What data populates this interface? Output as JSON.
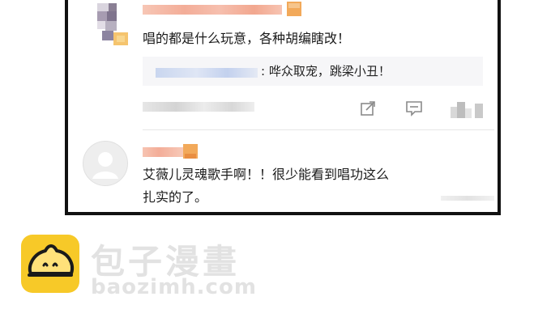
{
  "comments": [
    {
      "text": "唱的都是什么玩意，各种胡编瞎改！",
      "reply": {
        "text": ": 哗众取宠，跳梁小丑！"
      },
      "actions": [
        {
          "icon": "share-icon"
        },
        {
          "icon": "comment-icon"
        },
        {
          "icon": "like-icon"
        }
      ]
    },
    {
      "text_line1": "艾薇儿灵魂歌手啊！！很少能看到唱功这么",
      "text_line2": "扎实的了。"
    }
  ],
  "watermark": {
    "brand": "包子漫畫",
    "url": "baozimh.com"
  },
  "colors": {
    "username_pixel": "#f4b9a3",
    "badge_orange": "#f2a95a",
    "logo_yellow": "#f7c928",
    "watermark_gray": "#e2e2e2"
  }
}
